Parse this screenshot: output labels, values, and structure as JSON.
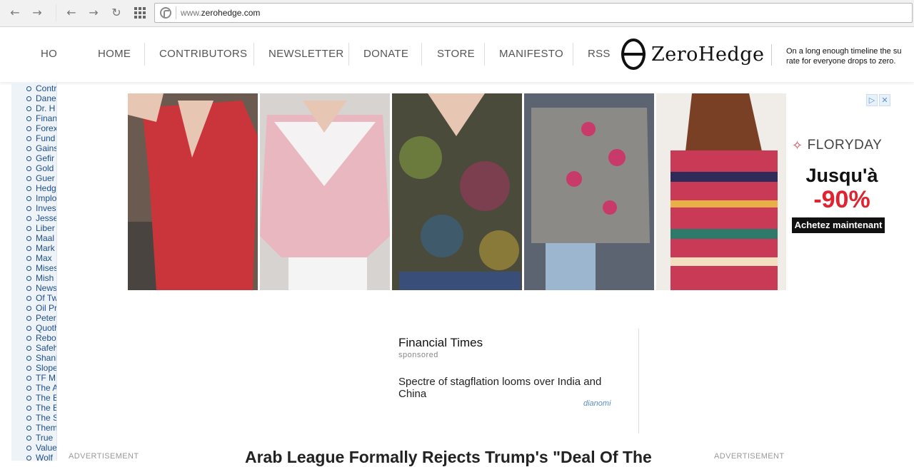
{
  "browser": {
    "url_prefix": "www.",
    "url_domain": "zerohedge.com"
  },
  "header": {
    "nav_cut": "HO",
    "nav": [
      "HOME",
      "CONTRIBUTORS",
      "NEWSLETTER",
      "DONATE",
      "STORE",
      "MANIFESTO",
      "RSS"
    ],
    "logo_text": "ZeroHedge",
    "tagline_1": "On a long enough timeline the su",
    "tagline_2": "rate for everyone drops to zero."
  },
  "sidebar": {
    "items": [
      "Contr",
      "Dane",
      "Dr. H",
      "Finan",
      "Forex",
      "Fund",
      "Gains",
      "Gefir",
      "Gold",
      "Guer",
      "Hedg",
      "Implo",
      "Inves",
      "Jesse",
      "Liber",
      "Maal",
      "Mark",
      "Max",
      "Mises",
      "Mish",
      "News",
      "Of Tw",
      "Oil Pr",
      "Peter",
      "Quoth",
      "Rebo",
      "Safeh",
      "Shank",
      "Slope",
      "TF M",
      "The A",
      "The B",
      "The E",
      "The S",
      "Them",
      "True",
      "Value",
      "Wolf"
    ]
  },
  "ad": {
    "brand": "FLORYDAY",
    "promo_1": "Jusqu'à",
    "promo_2": "-90%",
    "cta": "Achetez maintenant",
    "colors": {
      "sweater1": "#c9353a",
      "sweater2": "#e8b7c0",
      "sweater3": "#4a4b3a",
      "sweater4": "#8c8a86",
      "sweater5": "#c83a55"
    }
  },
  "sponsored": {
    "source": "Financial Times",
    "label": "sponsored",
    "headline": "Spectre of stagflation looms over India and China",
    "provider": "dianomi"
  },
  "bottom": {
    "adv_left": "ADVERTISEMENT",
    "adv_right": "ADVERTISEMENT",
    "article_title": "Arab League Formally Rejects Trump's \"Deal Of The"
  }
}
